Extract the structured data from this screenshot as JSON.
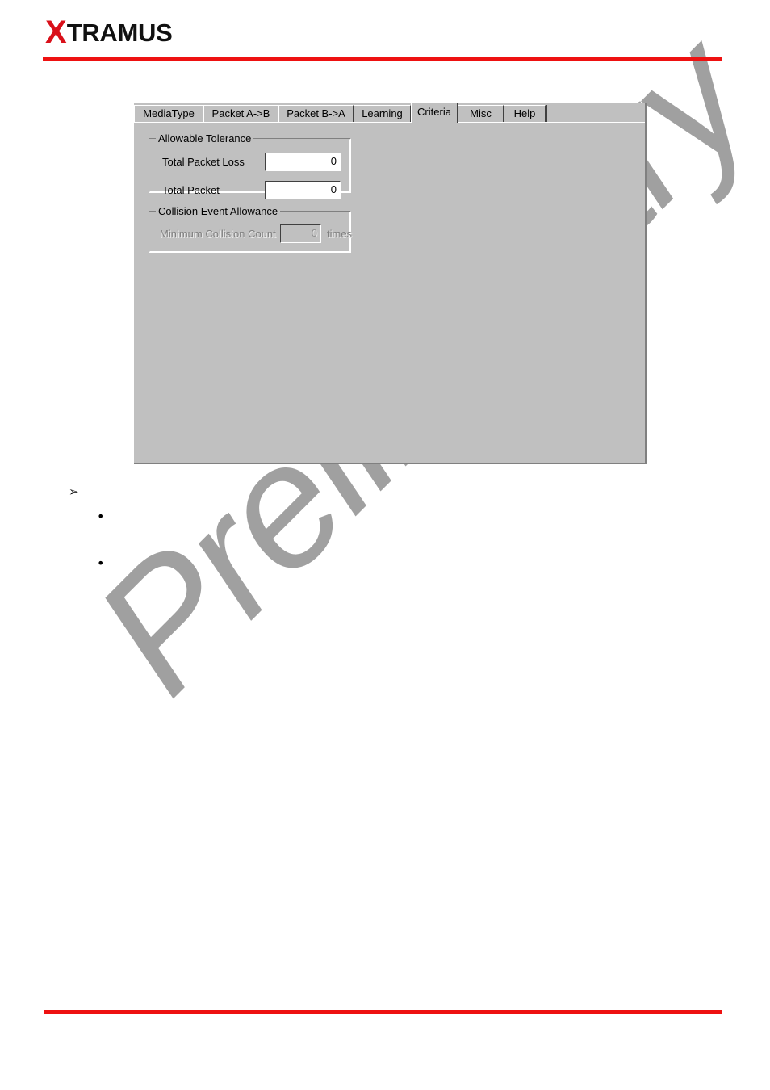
{
  "header": {
    "logo_x": "X",
    "logo_rest": "TRAMUS",
    "rule_color": "#ee1111"
  },
  "watermark": {
    "text": "Preliminary",
    "color": "#a0a0a0"
  },
  "dialog": {
    "background": "#c0c0c0",
    "tabs": [
      {
        "label": "MediaType",
        "active": false
      },
      {
        "label": "Packet A->B",
        "active": false
      },
      {
        "label": "Packet B->A",
        "active": false
      },
      {
        "label": "Learning",
        "active": false
      },
      {
        "label": "Criteria",
        "active": true
      },
      {
        "label": "Misc",
        "active": false
      },
      {
        "label": "Help",
        "active": false
      }
    ],
    "groups": [
      {
        "title": "Allowable Tolerance",
        "enabled": true,
        "fields": [
          {
            "label": "Total Packet Loss",
            "value": "0",
            "unit": "",
            "enabled": true
          },
          {
            "label": "Total Packet",
            "value": "0",
            "unit": "",
            "enabled": true
          }
        ]
      },
      {
        "title": "Collision Event Allowance",
        "enabled": false,
        "fields": [
          {
            "label": "Minimum Collision Count",
            "value": "0",
            "unit": "times",
            "enabled": false
          }
        ]
      }
    ]
  },
  "body_list": {
    "arrow_bullet_glyph": "➢",
    "round_bullet_glyph": "•",
    "items": [
      {
        "level": 0,
        "text": ""
      },
      {
        "level": 1,
        "text": ""
      },
      {
        "level": 1,
        "text": ""
      }
    ]
  }
}
